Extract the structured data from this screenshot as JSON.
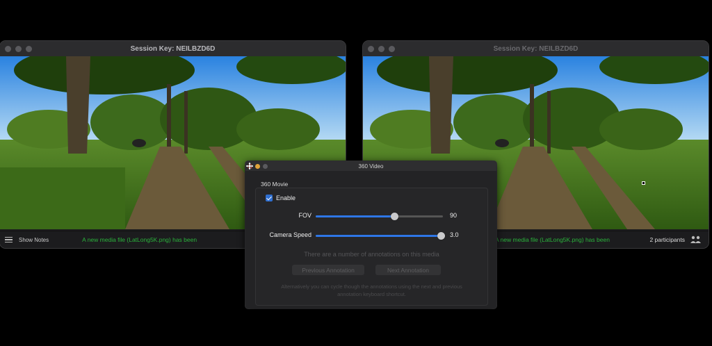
{
  "left_window": {
    "title": "Session Key: NEILBZD6D",
    "status": {
      "show_notes_label": "Show Notes",
      "notification": "A new media file (LatLong5K.png) has been"
    }
  },
  "right_window": {
    "title": "Session Key: NEILBZD6D",
    "status": {
      "notification": "A new media file (LatLong5K.png) has been",
      "participants": "2 participants"
    }
  },
  "dialog": {
    "title": "360 Video",
    "section_label": "360 Movie",
    "enable_label": "Enable",
    "enable_checked": true,
    "fov": {
      "label": "FOV",
      "value": "90",
      "fraction": 0.62
    },
    "camera_speed": {
      "label": "Camera Speed",
      "value": "3.0",
      "fraction": 1.0
    },
    "info_text": "There are a number of annotations on this media",
    "prev_button": "Previous Annotation",
    "next_button": "Next Annotation",
    "hint_text": "Alternatively you can cycle though the annotations using the next and previous annotation keyboard shortcut."
  },
  "colors": {
    "accent": "#2e76e6",
    "notification": "#2bb33c",
    "window_bg": "#1c1c1e"
  }
}
